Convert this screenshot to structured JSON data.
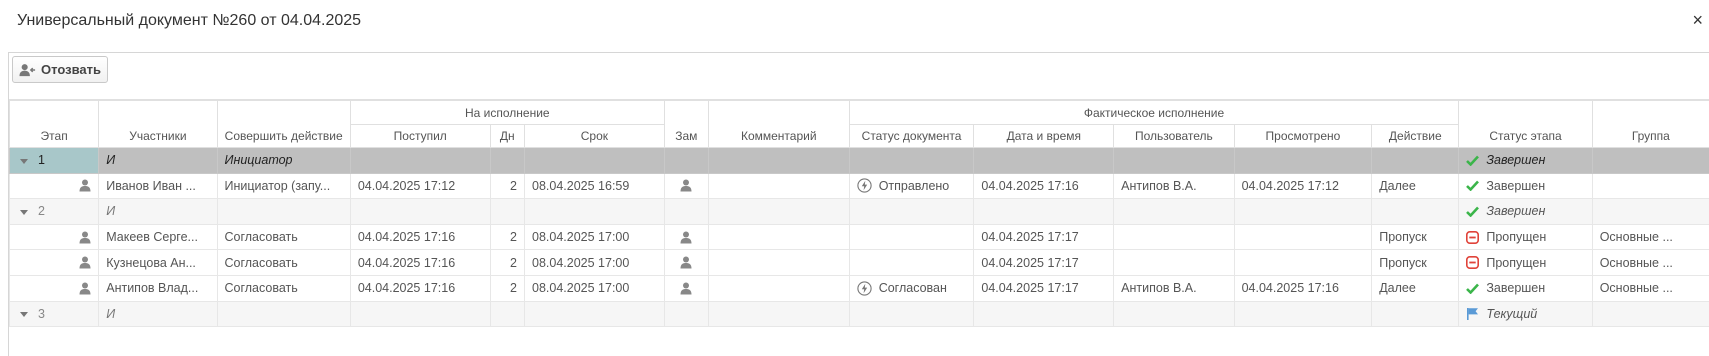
{
  "dialog": {
    "title": "Универсальный документ №260 от 04.04.2025",
    "close_label": "×"
  },
  "toolbar": {
    "recall_label": "Отозвать"
  },
  "columns": {
    "etap": "Этап",
    "uchastniki": "Участники",
    "sovershit": "Совершить действие",
    "na_ispolnenie": "На исполнение",
    "postupil": "Поступил",
    "dn": "Дн",
    "srok": "Срок",
    "zam": "Зам",
    "kommentariy": "Комментарий",
    "fakt": "Фактическое исполнение",
    "status_doc": "Статус документа",
    "data_vremya": "Дата и время",
    "polzovatel": "Пользователь",
    "prosmotreno": "Просмотрено",
    "deystvie": "Действие",
    "status_etapa": "Статус этапа",
    "gruppa": "Группа"
  },
  "rows": [
    {
      "stage": "1",
      "participant": "И",
      "action": "Инициатор",
      "status_stage": "Завершен"
    },
    {
      "participant": "Иванов Иван ...",
      "action": "Инициатор (запу...",
      "received": "04.04.2025 17:12",
      "days": "2",
      "deadline": "08.04.2025 16:59",
      "doc_status": "Отправлено",
      "datetime": "04.04.2025 17:16",
      "user": "Антипов В.А.",
      "viewed": "04.04.2025 17:12",
      "act": "Далее",
      "status_stage": "Завершен"
    },
    {
      "stage": "2",
      "participant": "И",
      "status_stage": "Завершен"
    },
    {
      "participant": "Макеев Серге...",
      "action": "Согласовать",
      "received": "04.04.2025 17:16",
      "days": "2",
      "deadline": "08.04.2025 17:00",
      "datetime": "04.04.2025 17:17",
      "act": "Пропуск",
      "status_stage": "Пропущен",
      "group": "Основные ..."
    },
    {
      "participant": "Кузнецова Ан...",
      "action": "Согласовать",
      "received": "04.04.2025 17:16",
      "days": "2",
      "deadline": "08.04.2025 17:00",
      "datetime": "04.04.2025 17:17",
      "act": "Пропуск",
      "status_stage": "Пропущен",
      "group": "Основные ..."
    },
    {
      "participant": "Антипов Влад...",
      "action": "Согласовать",
      "received": "04.04.2025 17:16",
      "days": "2",
      "deadline": "08.04.2025 17:00",
      "doc_status": "Согласован",
      "datetime": "04.04.2025 17:17",
      "user": "Антипов В.А.",
      "viewed": "04.04.2025 17:16",
      "act": "Далее",
      "status_stage": "Завершен",
      "group": "Основные ..."
    },
    {
      "stage": "3",
      "participant": "И",
      "status_stage": "Текущий"
    }
  ],
  "colors": {
    "done": "#3bb54a",
    "skipped": "#e0433a",
    "current": "#5a9ad6",
    "selected_row": "#bfbfbf"
  }
}
